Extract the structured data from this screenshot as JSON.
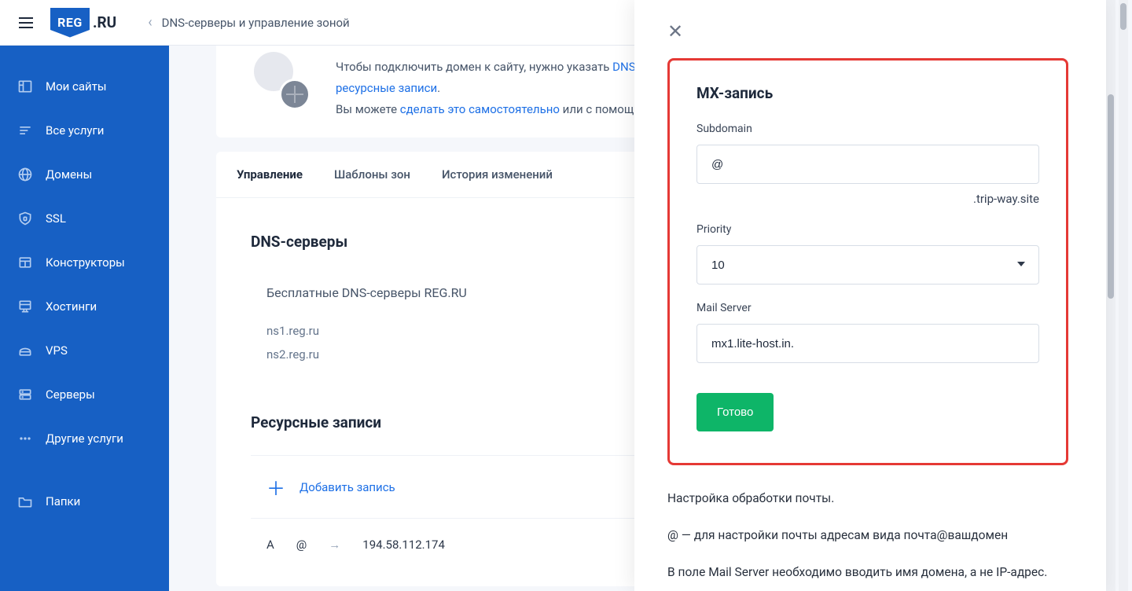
{
  "logo": {
    "brand_short": "REG",
    "brand_tld": ".RU"
  },
  "breadcrumb": "DNS-серверы и управление зоной",
  "sidebar": {
    "items": [
      {
        "label": "Мои сайты",
        "icon": "sites"
      },
      {
        "label": "Все услуги",
        "icon": "list"
      },
      {
        "label": "Домены",
        "icon": "globe"
      },
      {
        "label": "SSL",
        "icon": "lock"
      },
      {
        "label": "Конструкторы",
        "icon": "builder"
      },
      {
        "label": "Хостинги",
        "icon": "hosting"
      },
      {
        "label": "VPS",
        "icon": "vps"
      },
      {
        "label": "Серверы",
        "icon": "server"
      },
      {
        "label": "Другие услуги",
        "icon": "dots"
      },
      {
        "label": "Папки",
        "icon": "folder"
      }
    ]
  },
  "banner": {
    "line1_pre": "Чтобы подключить домен к сайту, нужно указать ",
    "link1": "DNS",
    "line2_link": "ресурсные записи",
    "line2_post": ".",
    "line3_pre": "Вы можете ",
    "link3": "сделать это самостоятельно",
    "line3_post": " или с помощь"
  },
  "tabs": [
    {
      "label": "Управление",
      "active": true
    },
    {
      "label": "Шаблоны зон",
      "active": false
    },
    {
      "label": "История изменений",
      "active": false
    }
  ],
  "dns": {
    "title": "DNS-серверы",
    "subtitle": "Бесплатные DNS-серверы REG.RU",
    "ns": [
      "ns1.reg.ru",
      "ns2.reg.ru"
    ]
  },
  "records": {
    "title": "Ресурсные записи",
    "add_label": "Добавить запись",
    "rows": [
      {
        "type": "A",
        "host": "@",
        "value": "194.58.112.174"
      }
    ]
  },
  "panel": {
    "title": "MX-запись",
    "subdomain_label": "Subdomain",
    "subdomain_value": "@",
    "domain_suffix": ".trip-way.site",
    "priority_label": "Priority",
    "priority_value": "10",
    "mailserver_label": "Mail Server",
    "mailserver_value": "mx1.lite-host.in.",
    "submit_label": "Готово",
    "help": [
      "Настройка обработки почты.",
      "@ — для настройки почты адресам вида почта@вашдомен",
      "В поле Mail Server необходимо вводить имя домена, а не IP-адрес."
    ]
  }
}
